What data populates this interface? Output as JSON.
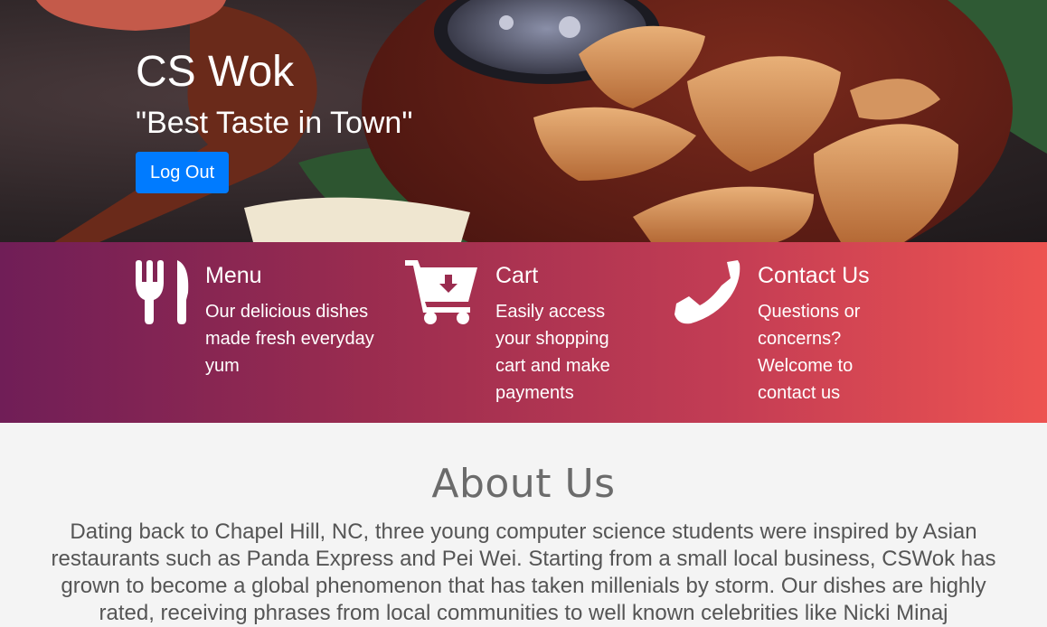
{
  "hero": {
    "title": "CS Wok",
    "tagline": "\"Best Taste in Town\"",
    "logout_label": "Log Out"
  },
  "features": [
    {
      "icon": "fork-knife-icon",
      "title": "Menu",
      "text": "Our delicious dishes made fresh everyday yum"
    },
    {
      "icon": "cart-icon",
      "title": "Cart",
      "text": "Easily access your shopping cart and make payments"
    },
    {
      "icon": "phone-icon",
      "title": "Contact Us",
      "text": "Questions or concerns? Welcome to contact us"
    }
  ],
  "about": {
    "heading": "About Us",
    "text": "Dating back to Chapel Hill, NC, three young computer science students were inspired by Asian restaurants such as Panda Express and Pei Wei. Starting from a small local business, CSWok has grown to become a global phenomenon that has taken millenials by storm. Our dishes are highly rated, receiving phrases from local communities to well known celebrities like Nicki Minaj"
  },
  "colors": {
    "button": "#007bff",
    "band_start": "#701e57",
    "band_end": "#ed5351",
    "about_bg": "#f4f4f4"
  }
}
